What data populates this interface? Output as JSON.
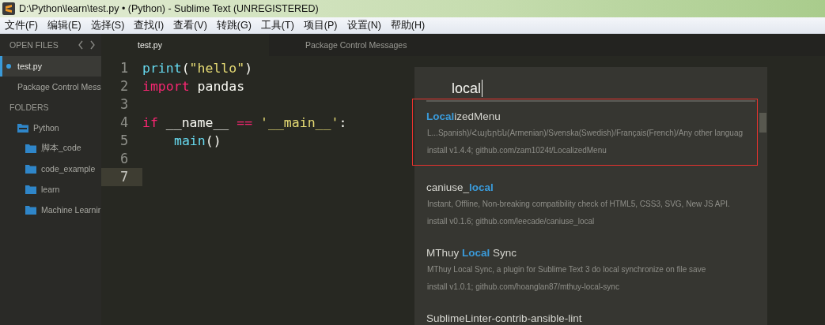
{
  "window": {
    "title": "D:\\Python\\learn\\test.py • (Python) - Sublime Text (UNREGISTERED)"
  },
  "menu": [
    "文件(F)",
    "编辑(E)",
    "选择(S)",
    "查找(I)",
    "查看(V)",
    "转跳(G)",
    "工具(T)",
    "项目(P)",
    "设置(N)",
    "帮助(H)"
  ],
  "sidebar": {
    "open_files_heading": "OPEN FILES",
    "open_files": [
      {
        "name": "test.py",
        "selected": true,
        "modified": true
      },
      {
        "name": "Package Control Mess",
        "selected": false,
        "modified": false
      }
    ],
    "folders_heading": "FOLDERS",
    "folders": [
      {
        "name": "Python",
        "expanded": true,
        "children": [
          {
            "name": "脚本_code"
          },
          {
            "name": "code_example"
          },
          {
            "name": "learn"
          },
          {
            "name": "Machine Learnir"
          }
        ]
      }
    ]
  },
  "tabs": [
    {
      "label": "test.py",
      "selected": true
    },
    {
      "label": "Package Control Messages",
      "selected": false
    }
  ],
  "editor": {
    "lines": [
      {
        "number": "1",
        "current": false,
        "tokens": [
          {
            "kind": "func",
            "text": "print"
          },
          {
            "kind": "plain",
            "text": "("
          },
          {
            "kind": "string",
            "text": "\"hello\""
          },
          {
            "kind": "plain",
            "text": ")"
          }
        ]
      },
      {
        "number": "2",
        "current": false,
        "tokens": [
          {
            "kind": "keyword",
            "text": "import"
          },
          {
            "kind": "plain",
            "text": " pandas"
          }
        ]
      },
      {
        "number": "3",
        "current": false
      },
      {
        "number": "4",
        "current": false,
        "tokens": [
          {
            "kind": "keyword",
            "text": "if"
          },
          {
            "kind": "plain",
            "text": " __name__ "
          },
          {
            "kind": "keyword",
            "text": "=="
          },
          {
            "kind": "string",
            "text": " '__main__'"
          },
          {
            "kind": "plain",
            "text": ":"
          }
        ]
      },
      {
        "number": "5",
        "current": false,
        "indented": true,
        "tokens": [
          {
            "kind": "func",
            "text": "main"
          },
          {
            "kind": "plain",
            "text": "()"
          }
        ]
      },
      {
        "number": "6",
        "current": false
      },
      {
        "number": "7",
        "current": true
      }
    ]
  },
  "palette": {
    "value": "local",
    "results": [
      {
        "name": "**Local**izedMenu",
        "annotated": true,
        "description": "L...Spanish)/Հայերեն(Armenian)/Svenska(Swedish)/Français(French)/Any other languag",
        "install": "install v1.4.4; github.com/zam1024t/LocalizedMenu"
      },
      {
        "name": "caniuse_**local**",
        "annotated": false,
        "description": "Instant, Offline, Non-breaking compatibility check of HTML5, CSS3, SVG, New JS API.",
        "install": "install v0.1.6; github.com/leecade/caniuse_local"
      },
      {
        "name": "MThuy **Local** Sync",
        "annotated": false,
        "description": "MThuy Local Sync, a plugin for Sublime Text 3 do local synchronize on file save",
        "install": "install v1.0.1; github.com/hoanglan87/mthuy-local-sync"
      },
      {
        "name": "SublimeLinter-contrib-ansible-lint",
        "annotated": false
      }
    ]
  }
}
